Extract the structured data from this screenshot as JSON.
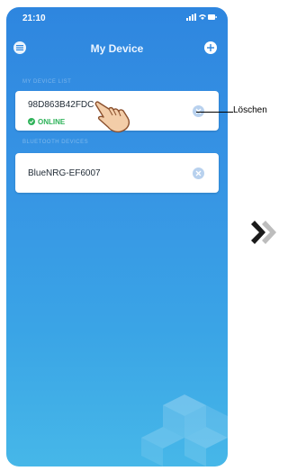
{
  "status_bar": {
    "time": "21:10",
    "icons": [
      "signal-icon",
      "wifi-icon",
      "battery-icon"
    ]
  },
  "navbar": {
    "title": "My Device",
    "left_icon": "menu-icon",
    "right_icon": "add-icon"
  },
  "sections": {
    "my_devices_label": "MY DEVICE LIST",
    "bluetooth_label": "BLUETOOTH DEVICES"
  },
  "devices": [
    {
      "name": "98D863B42FDC",
      "status": "ONLINE"
    },
    {
      "name": "BlueNRG-EF6007"
    }
  ],
  "annotation": {
    "label": "Löschen"
  },
  "colors": {
    "accent": "#2e86df",
    "online": "#2fb35a"
  }
}
